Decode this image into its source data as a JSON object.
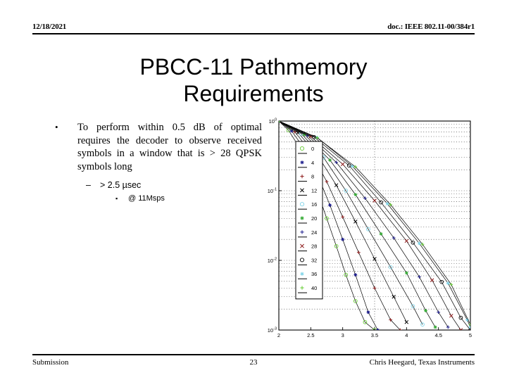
{
  "header": {
    "date": "12/18/2021",
    "doc": "doc.: IEEE 802.11-00/384r1"
  },
  "title": {
    "line1": "PBCC-11 Pathmemory",
    "line2": "Requirements"
  },
  "body": {
    "bullet_marker": "•",
    "bullet1": "To perform within 0.5 dB of optimal requires the decoder to observe received symbols in a window that is > 28 QPSK symbols long",
    "sub_marker": "–",
    "sub1": "> 2.5 µsec",
    "subsub_marker": "▪",
    "sub2": "@ 11Msps"
  },
  "footer": {
    "left": "Submission",
    "page": "23",
    "right": "Chris Heegard, Texas Instruments"
  },
  "chart_data": {
    "type": "line",
    "title": "",
    "xlabel": "",
    "ylabel": "",
    "xlim": [
      2,
      5
    ],
    "ylim": [
      0.001,
      1
    ],
    "yscale": "log",
    "grid": true,
    "legend_position": "left",
    "xticks": [
      "2",
      "2.5",
      "3",
      "3.5",
      "4",
      "4.5",
      "5"
    ],
    "xtick_values": [
      2,
      2.5,
      3,
      3.5,
      4,
      4.5,
      5
    ],
    "yticks": [
      "10^0",
      "10^-1",
      "10^-2",
      "10^-3"
    ],
    "ytick_values": [
      1,
      0.1,
      0.01,
      0.001
    ],
    "series": [
      {
        "name": "0",
        "marker": "circle",
        "color": "#66cc33",
        "x": [
          2.0,
          2.15,
          2.3,
          2.45,
          2.6,
          2.75,
          2.9,
          3.05,
          3.2,
          3.35,
          3.5
        ],
        "y": [
          1.0,
          0.74,
          0.45,
          0.22,
          0.1,
          0.04,
          0.016,
          0.0062,
          0.0026,
          0.0013,
          0.001
        ]
      },
      {
        "name": "4",
        "marker": "star",
        "color": "#1a1a8c",
        "x": [
          2.0,
          2.2,
          2.4,
          2.6,
          2.8,
          3.0,
          3.2,
          3.4,
          3.55
        ],
        "y": [
          1.0,
          0.72,
          0.4,
          0.175,
          0.062,
          0.02,
          0.0062,
          0.0018,
          0.001
        ]
      },
      {
        "name": "8",
        "marker": "plus",
        "color": "#8c1a1a",
        "x": [
          2.0,
          2.25,
          2.5,
          2.75,
          3.0,
          3.25,
          3.5,
          3.75,
          3.9
        ],
        "y": [
          1.0,
          0.7,
          0.36,
          0.135,
          0.042,
          0.013,
          0.004,
          0.0014,
          0.001
        ]
      },
      {
        "name": "12",
        "marker": "x",
        "color": "#000000",
        "x": [
          2.0,
          2.3,
          2.6,
          2.9,
          3.2,
          3.5,
          3.8,
          4.0
        ],
        "y": [
          1.0,
          0.68,
          0.33,
          0.12,
          0.036,
          0.0105,
          0.003,
          0.0013
        ]
      },
      {
        "name": "16",
        "marker": "circle",
        "color": "#7fd4e8",
        "x": [
          2.0,
          2.35,
          2.7,
          3.05,
          3.4,
          3.75,
          4.1,
          4.25
        ],
        "y": [
          1.0,
          0.66,
          0.3,
          0.1,
          0.028,
          0.008,
          0.0022,
          0.0012
        ]
      },
      {
        "name": "20",
        "marker": "star",
        "color": "#33aa33",
        "x": [
          2.0,
          2.4,
          2.8,
          3.2,
          3.6,
          4.0,
          4.3,
          4.45
        ],
        "y": [
          1.0,
          0.64,
          0.275,
          0.088,
          0.024,
          0.0066,
          0.0019,
          0.0011
        ]
      },
      {
        "name": "24",
        "marker": "plus",
        "color": "#1a1a8c",
        "x": [
          2.0,
          2.45,
          2.9,
          3.35,
          3.8,
          4.2,
          4.5,
          4.65
        ],
        "y": [
          1.0,
          0.62,
          0.255,
          0.078,
          0.021,
          0.0058,
          0.0018,
          0.0011
        ]
      },
      {
        "name": "28",
        "marker": "x",
        "color": "#8c1a1a",
        "x": [
          2.0,
          2.5,
          3.0,
          3.5,
          4.0,
          4.4,
          4.7,
          4.85
        ],
        "y": [
          1.0,
          0.6,
          0.24,
          0.072,
          0.019,
          0.0052,
          0.0016,
          0.001
        ]
      },
      {
        "name": "32",
        "marker": "circle",
        "color": "#000000",
        "x": [
          2.0,
          2.55,
          3.1,
          3.6,
          4.1,
          4.55,
          4.85,
          5.0
        ],
        "y": [
          1.0,
          0.59,
          0.23,
          0.068,
          0.018,
          0.0049,
          0.0015,
          0.001
        ]
      },
      {
        "name": "36",
        "marker": "star",
        "color": "#7fd4e8",
        "x": [
          2.0,
          2.6,
          3.15,
          3.7,
          4.2,
          4.65,
          4.95,
          5.0
        ],
        "y": [
          1.0,
          0.58,
          0.225,
          0.065,
          0.0175,
          0.0047,
          0.0014,
          0.0011
        ]
      },
      {
        "name": "40",
        "marker": "plus",
        "color": "#66cc33",
        "x": [
          2.0,
          2.6,
          3.2,
          3.75,
          4.25,
          4.7,
          5.0
        ],
        "y": [
          1.0,
          0.575,
          0.22,
          0.063,
          0.017,
          0.0045,
          0.0012
        ]
      }
    ]
  }
}
